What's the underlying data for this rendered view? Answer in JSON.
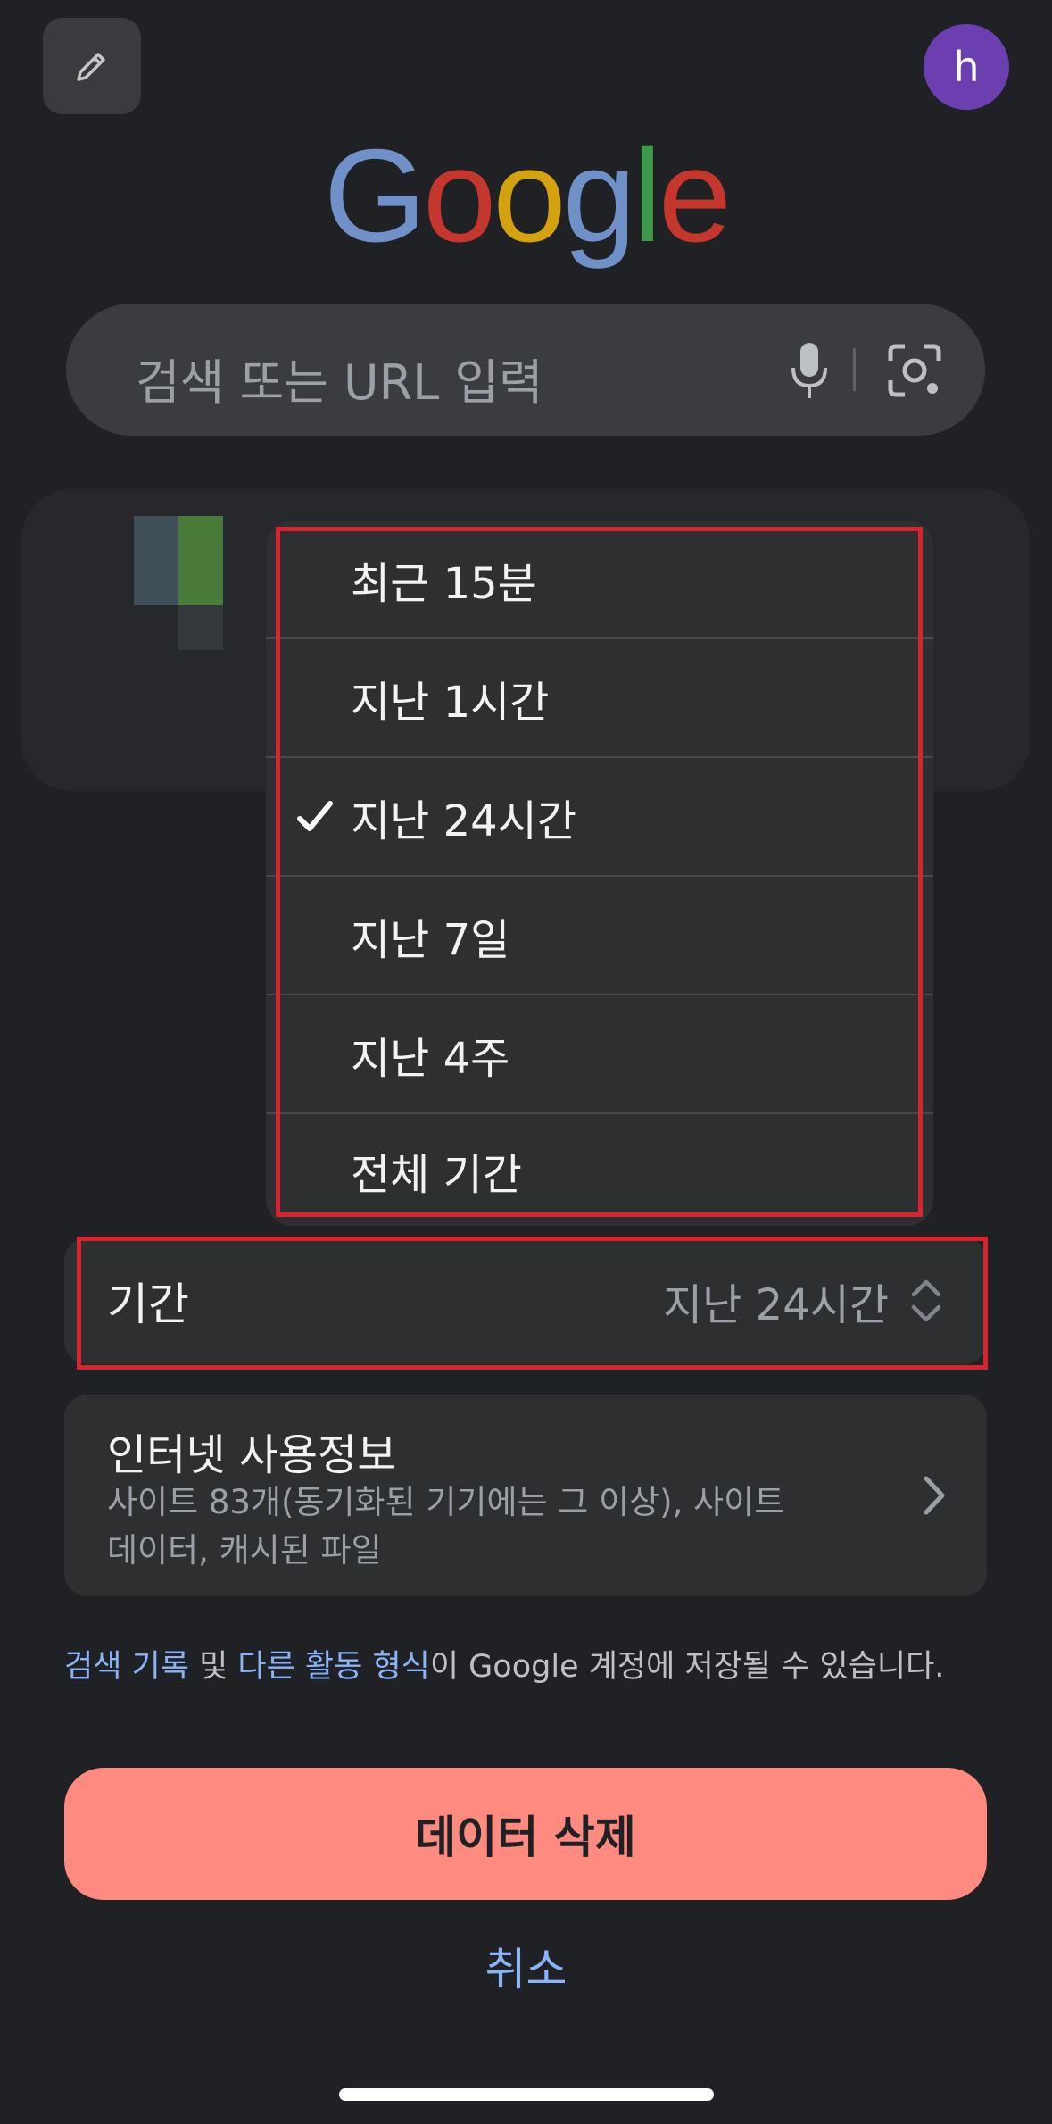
{
  "top": {
    "avatar_initial": "h",
    "avatar_color": "#6c3fb0"
  },
  "logo": {
    "letters": [
      "G",
      "o",
      "o",
      "g",
      "l",
      "e"
    ],
    "colors": [
      "#7090c8",
      "#c5372c",
      "#d4a20e",
      "#7090c8",
      "#3c9a4a",
      "#c5372c"
    ]
  },
  "search": {
    "placeholder": "검색 또는 URL 입력",
    "icons": [
      "mic-icon",
      "lens-icon"
    ]
  },
  "menu": {
    "items": [
      {
        "label": "최근 15분",
        "checked": false
      },
      {
        "label": "지난 1시간",
        "checked": false
      },
      {
        "label": "지난 24시간",
        "checked": true
      },
      {
        "label": "지난 7일",
        "checked": false
      },
      {
        "label": "지난 4주",
        "checked": false
      },
      {
        "label": "전체 기간",
        "checked": false
      }
    ],
    "check_glyph": "✓"
  },
  "period": {
    "label": "기간",
    "value": "지난 24시간"
  },
  "browsing": {
    "title": "인터넷 사용정보",
    "description": "사이트 83개(동기화된 기기에는 그 이상), 사이트 데이터, 캐시된 파일"
  },
  "info": {
    "link1": "검색 기록",
    "conj": " 및 ",
    "link2": "다른 활동 형식",
    "rest": "이 Google 계정에 저장될 수 있습니다."
  },
  "actions": {
    "delete_label": "데이터 삭제",
    "delete_color": "#ff8a80",
    "cancel_label": "취소",
    "cancel_color": "#8ab4f8"
  },
  "colors": {
    "highlight": "#d9232f",
    "link": "#8ab4f8"
  }
}
